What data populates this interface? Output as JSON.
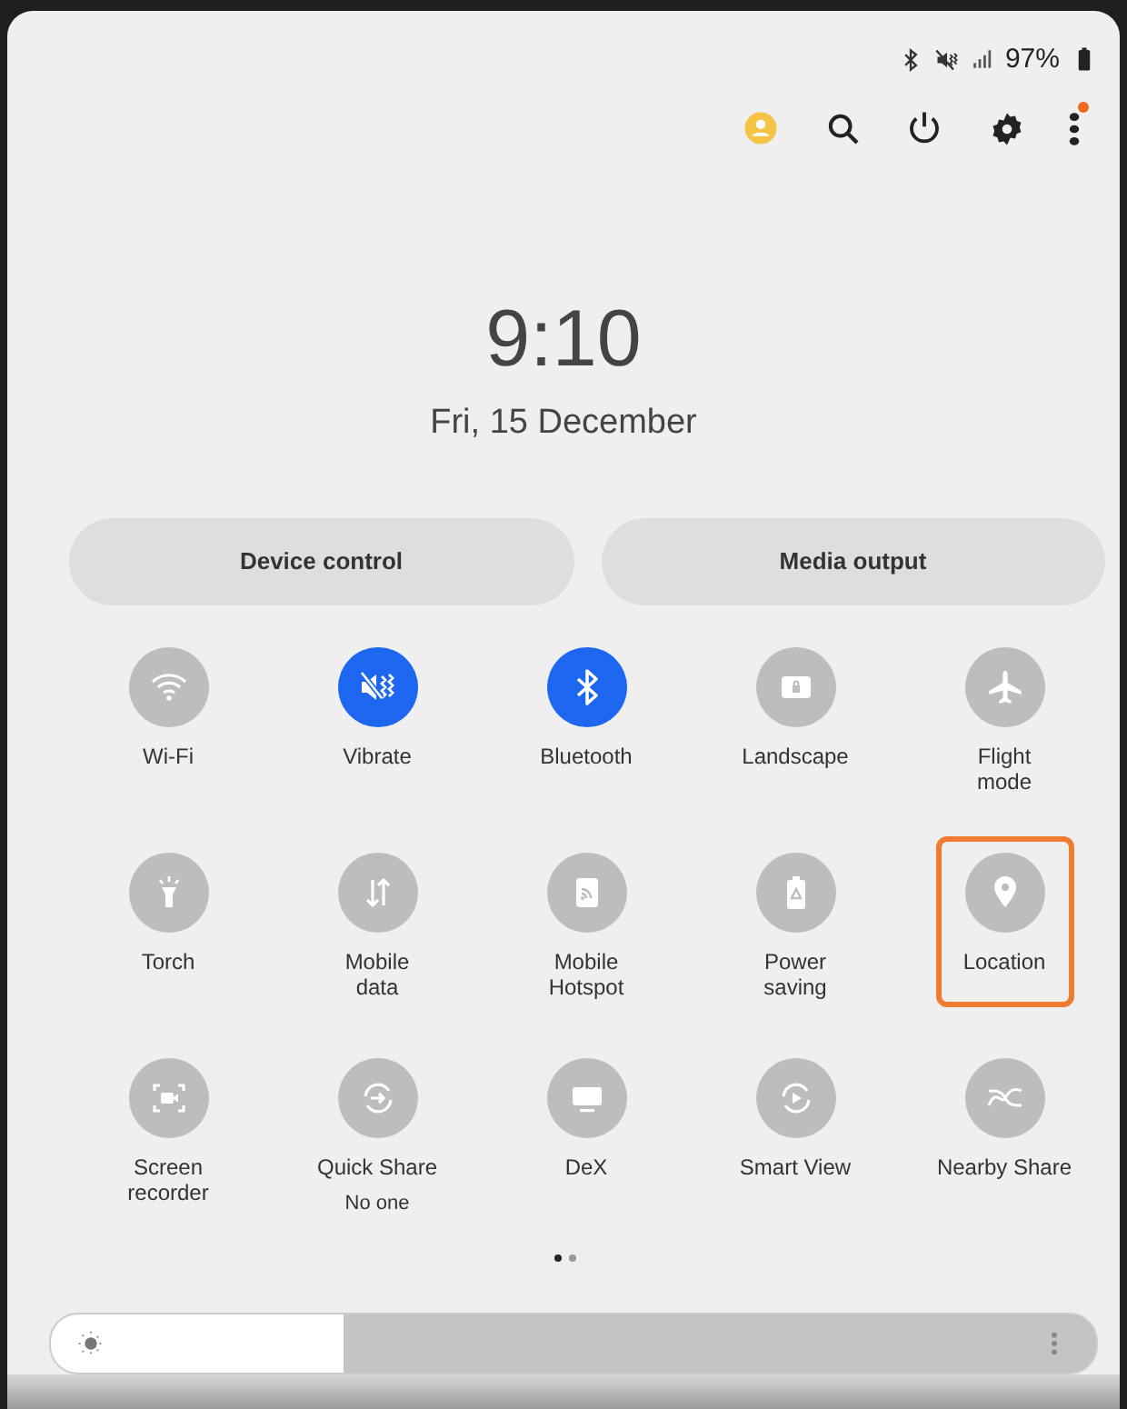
{
  "status_bar": {
    "battery": "97%"
  },
  "toolbar": {
    "notification_dot": true
  },
  "clock": {
    "time": "9:10",
    "date": "Fri, 15 December"
  },
  "pills": [
    "Device control",
    "Media output"
  ],
  "tiles": [
    {
      "label": "Wi-Fi",
      "on": false,
      "highlighted": false
    },
    {
      "label": "Vibrate",
      "on": true,
      "highlighted": false
    },
    {
      "label": "Bluetooth",
      "on": true,
      "highlighted": false
    },
    {
      "label": "Landscape",
      "on": false,
      "highlighted": false
    },
    {
      "label": "Flight\nmode",
      "on": false,
      "highlighted": false
    },
    {
      "label": "Torch",
      "on": false,
      "highlighted": false
    },
    {
      "label": "Mobile\ndata",
      "on": false,
      "highlighted": false
    },
    {
      "label": "Mobile\nHotspot",
      "on": false,
      "highlighted": false
    },
    {
      "label": "Power\nsaving",
      "on": false,
      "highlighted": false
    },
    {
      "label": "Location",
      "on": false,
      "highlighted": true
    },
    {
      "label": "Screen\nrecorder",
      "on": false,
      "highlighted": false
    },
    {
      "label": "Quick Share",
      "subtitle": "No one",
      "on": false,
      "highlighted": false
    },
    {
      "label": "DeX",
      "on": false,
      "highlighted": false
    },
    {
      "label": "Smart View",
      "on": false,
      "highlighted": false
    },
    {
      "label": "Nearby Share",
      "on": false,
      "highlighted": false
    }
  ],
  "pager": [
    {
      "selected": true
    },
    {
      "selected": false
    }
  ],
  "brightness": {
    "level": 0.28
  }
}
